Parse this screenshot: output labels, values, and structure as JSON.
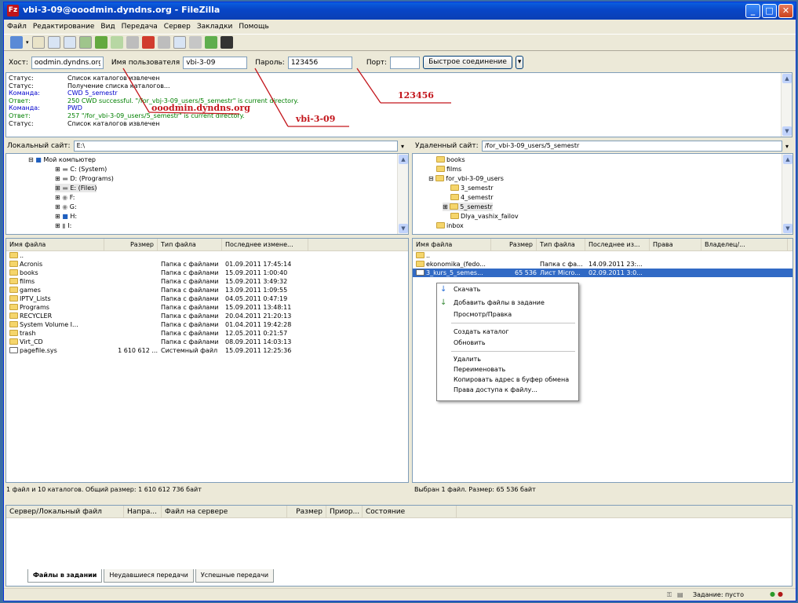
{
  "window": {
    "title": "vbi-3-09@ooodmin.dyndns.org - FileZilla"
  },
  "menu": [
    "Файл",
    "Редактирование",
    "Вид",
    "Передача",
    "Сервер",
    "Закладки",
    "Помощь"
  ],
  "quickconnect": {
    "host_label": "Хост:",
    "host": "oodmin.dyndns.org",
    "user_label": "Имя пользователя",
    "user": "vbi-3-09",
    "pass_label": "Пароль:",
    "pass": "123456",
    "port_label": "Порт:",
    "port": "",
    "button": "Быстрое соединение"
  },
  "log": [
    {
      "k": "Статус:",
      "v": "Список каталогов извлечен",
      "c": "#000000"
    },
    {
      "k": "Статус:",
      "v": "Получение списка каталогов...",
      "c": "#000000"
    },
    {
      "k": "Команда:",
      "v": "CWD 5_semestr",
      "c": "#0000cc"
    },
    {
      "k": "Ответ:",
      "v": "250 CWD successful. \"/for_vbj-3-09_users/5_semestr\" is current directory.",
      "c": "#008000"
    },
    {
      "k": "Команда:",
      "v": "PWD",
      "c": "#0000cc"
    },
    {
      "k": "Ответ:",
      "v": "257 \"/for_vbi-3-09_users/5_semestr\" is current directory.",
      "c": "#008000"
    },
    {
      "k": "Статус:",
      "v": "Список каталогов извлечен",
      "c": "#000000"
    }
  ],
  "annotations": {
    "host": "ooodmin.dyndns.org",
    "user": "vbi-3-09",
    "pass": "123456"
  },
  "local": {
    "label": "Локальный сайт:",
    "path": "E:\\",
    "tree": [
      "Мой компьютер",
      "C: (System)",
      "D: (Programs)",
      "E: (Files)",
      "F:",
      "G:",
      "H:",
      "I:"
    ],
    "headers": [
      "Имя файла",
      "Размер",
      "Тип файла",
      "Последнее измене..."
    ],
    "files": [
      [
        "..",
        "",
        "",
        ""
      ],
      [
        "Acronis",
        "",
        "Папка с файлами",
        "01.09.2011 17:45:14"
      ],
      [
        "books",
        "",
        "Папка с файлами",
        "15.09.2011 1:00:40"
      ],
      [
        "films",
        "",
        "Папка с файлами",
        "15.09.2011 3:49:32"
      ],
      [
        "games",
        "",
        "Папка с файлами",
        "13.09.2011 1:09:55"
      ],
      [
        "IPTV_Lists",
        "",
        "Папка с файлами",
        "04.05.2011 0:47:19"
      ],
      [
        "Programs",
        "",
        "Папка с файлами",
        "15.09.2011 13:48:11"
      ],
      [
        "RECYCLER",
        "",
        "Папка с файлами",
        "20.04.2011 21:20:13"
      ],
      [
        "System Volume I...",
        "",
        "Папка с файлами",
        "01.04.2011 19:42:28"
      ],
      [
        "trash",
        "",
        "Папка с файлами",
        "12.05.2011 0:21:57"
      ],
      [
        "Virt_CD",
        "",
        "Папка с файлами",
        "08.09.2011 14:03:13"
      ],
      [
        "pagefile.sys",
        "1 610 612 ...",
        "Системный файл",
        "15.09.2011 12:25:36"
      ]
    ],
    "status": "1 файл и 10 каталогов. Общий размер: 1 610 612 736 байт"
  },
  "remote": {
    "label": "Удаленный сайт:",
    "path": "/for_vbi-3-09_users/5_semestr",
    "tree": [
      "books",
      "films",
      "for_vbi-3-09_users",
      "3_semestr",
      "4_semestr",
      "5_semestr",
      "Dlya_vashix_failov",
      "inbox"
    ],
    "headers": [
      "Имя файла",
      "Размер",
      "Тип файла",
      "Последнее из...",
      "Права",
      "Владелец/..."
    ],
    "files": [
      [
        "..",
        "",
        "",
        ""
      ],
      [
        "ekonomika_(fedo...",
        "",
        "Папка с фа...",
        "14.09.2011 23:..."
      ],
      [
        "3_kurs_5_semes...",
        "65 536",
        "Лист Micro...",
        "02.09.2011 3:0..."
      ]
    ],
    "status": "Выбран 1 файл. Размер: 65 536 байт"
  },
  "context_menu": [
    "Скачать",
    "Добавить файлы в задание",
    "Просмотр/Правка",
    "Создать каталог",
    "Обновить",
    "Удалить",
    "Переименовать",
    "Копировать адрес в буфер обмена",
    "Права доступа к файлу..."
  ],
  "queue": {
    "headers": [
      "Сервер/Локальный файл",
      "Напра...",
      "Файл на сервере",
      "Размер",
      "Приор...",
      "Состояние"
    ],
    "tabs": [
      "Файлы в задании",
      "Неудавшиеся передачи",
      "Успешные передачи"
    ]
  },
  "statusbar": {
    "queue": "Задание: пусто"
  }
}
